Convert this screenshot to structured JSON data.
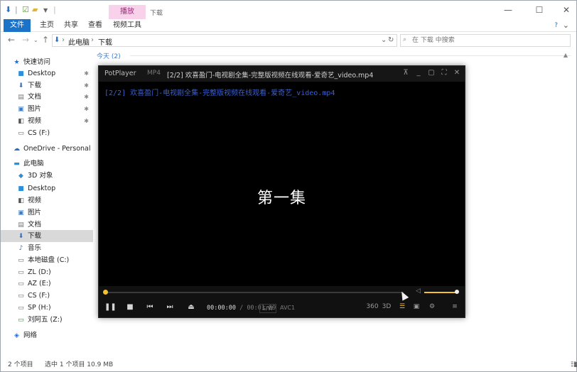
{
  "titlebar": {
    "context_tab": "播放",
    "title": "下载",
    "minimize_glyph": "—",
    "maximize_glyph": "☐",
    "close_glyph": "✕"
  },
  "ribbon": {
    "tabs": [
      "文件",
      "主页",
      "共享",
      "查看",
      "视频工具"
    ]
  },
  "address": {
    "crumbs": [
      "此电脑",
      "下载"
    ],
    "search_placeholder": "在 下载 中搜索"
  },
  "sidebar": {
    "items": [
      {
        "label": "快速访问",
        "icon": "star-icon"
      },
      {
        "label": "Desktop",
        "icon": "desktop-folder-icon",
        "pinned": true
      },
      {
        "label": "下载",
        "icon": "download-arrow-icon",
        "pinned": true
      },
      {
        "label": "文档",
        "icon": "document-icon",
        "pinned": true
      },
      {
        "label": "图片",
        "icon": "picture-icon",
        "pinned": true
      },
      {
        "label": "视频",
        "icon": "video-icon",
        "pinned": true
      },
      {
        "label": "CS (F:)",
        "icon": "drive-icon"
      },
      {
        "label": "OneDrive - Personal",
        "icon": "cloud-icon"
      },
      {
        "label": "此电脑",
        "icon": "computer-icon"
      },
      {
        "label": "3D 对象",
        "icon": "cube-icon"
      },
      {
        "label": "Desktop",
        "icon": "desktop-folder-icon"
      },
      {
        "label": "视频",
        "icon": "video-icon"
      },
      {
        "label": "图片",
        "icon": "picture-icon"
      },
      {
        "label": "文档",
        "icon": "document-icon"
      },
      {
        "label": "下载",
        "icon": "download-arrow-icon",
        "selected": true
      },
      {
        "label": "音乐",
        "icon": "music-icon"
      },
      {
        "label": "本地磁盘 (C:)",
        "icon": "drive-icon"
      },
      {
        "label": "ZL (D:)",
        "icon": "drive-icon"
      },
      {
        "label": "AZ (E:)",
        "icon": "drive-icon"
      },
      {
        "label": "CS (F:)",
        "icon": "drive-icon"
      },
      {
        "label": "SP (H:)",
        "icon": "drive-icon"
      },
      {
        "label": "刘阿五 (Z:)",
        "icon": "network-drive-icon"
      },
      {
        "label": "网络",
        "icon": "network-icon"
      }
    ]
  },
  "content": {
    "group_header": "今天 (2)"
  },
  "status": {
    "item_count": "2 个项目",
    "selection": "选中 1 个项目  10.9 MB"
  },
  "player": {
    "app_name": "PotPlayer",
    "format": "MP4",
    "window_title": "[2/2] 欢喜盈门-电视剧全集-完整版视频在线观看-爱奇艺_video.mp4",
    "osd_text": "[2/2] 欢喜盈门-电视剧全集-完整版视频在线观看-爱奇艺_video.mp4",
    "subtitle": "第一集",
    "time_current": "00:00:00",
    "time_total": "/ 00:01:09",
    "tag_decoder": "S/W",
    "tag_codec": "AVC1",
    "btn_360": "360",
    "btn_3d": "3D",
    "seek_fraction": 0.0,
    "volume_fraction": 1.0,
    "accent": "#f2c12e"
  }
}
